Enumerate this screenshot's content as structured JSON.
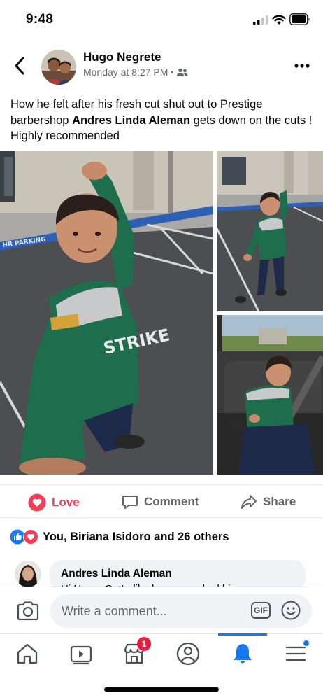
{
  "status_bar": {
    "time": "9:48"
  },
  "post": {
    "author": "Hugo Negrete",
    "timestamp": "Monday at 8:27 PM",
    "audience_icon": "friends-icon",
    "text_part1": "How he felt after his fresh cut shut out to Prestige barbershop ",
    "text_tag": "Andres Linda Aleman",
    "text_part2": " gets down on the cuts ! Highly recommended"
  },
  "photos": {
    "parking_text": "HR PARKING",
    "shirt_text": "STRIKE"
  },
  "actions": {
    "love": "Love",
    "comment": "Comment",
    "share": "Share"
  },
  "reactions": {
    "summary": "You, Biriana Isidoro and 26 others",
    "icons": [
      "like-icon",
      "love-icon"
    ]
  },
  "comment_preview": {
    "name": "Andres Linda Aleman",
    "text": "Hi Hugo, Gotta like how ya rocked his"
  },
  "composer": {
    "placeholder": "Write a comment...",
    "gif_label": "GIF"
  },
  "tabbar": {
    "items": [
      "home-icon",
      "watch-icon",
      "marketplace-icon",
      "profile-icon",
      "notifications-icon",
      "menu-icon"
    ],
    "marketplace_badge": "1",
    "active": "notifications-icon",
    "accent": "#1877f2"
  },
  "colors": {
    "love": "#f33e58",
    "secondary_text": "#65676b",
    "badge": "#e41e3f"
  }
}
